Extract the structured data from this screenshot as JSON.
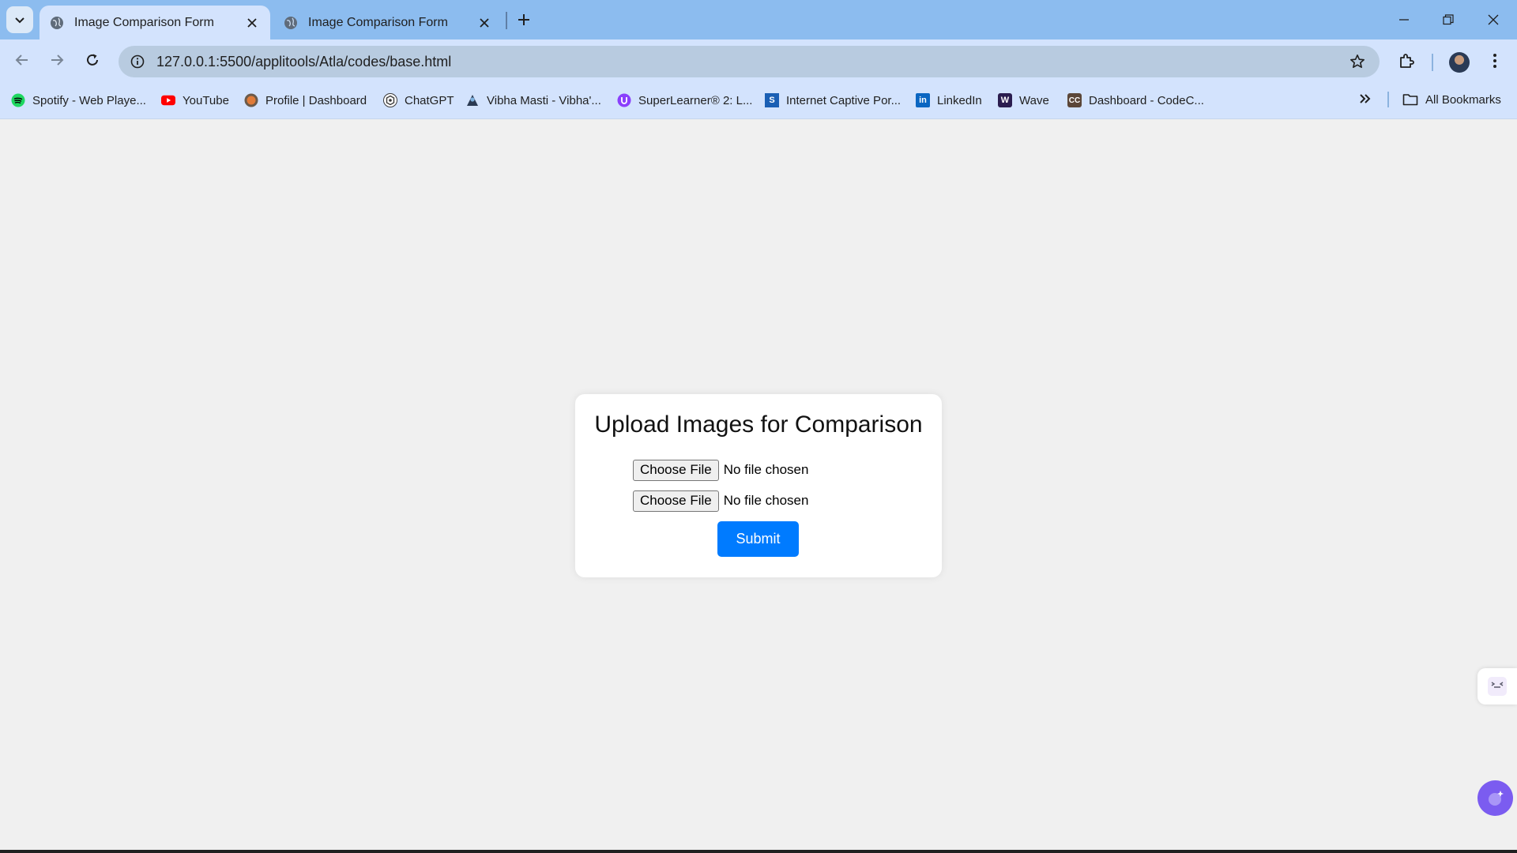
{
  "browser": {
    "tabs": [
      {
        "title": "Image Comparison Form",
        "active": true
      },
      {
        "title": "Image Comparison Form",
        "active": false
      }
    ],
    "address_bar": {
      "url": "127.0.0.1:5500/applitools/Atla/codes/base.html"
    },
    "bookmarks": [
      {
        "label": "Spotify - Web Playe...",
        "icon": "spotify-icon",
        "color": "#1ed760"
      },
      {
        "label": "YouTube",
        "icon": "youtube-icon",
        "color": "#ff0000"
      },
      {
        "label": "Profile | Dashboard",
        "icon": "profile-icon",
        "color": "#e07b39"
      },
      {
        "label": "ChatGPT",
        "icon": "chatgpt-icon",
        "color": "#3a3a3a"
      },
      {
        "label": "Vibha Masti - Vibha'...",
        "icon": "vibha-icon",
        "color": "#2b3a52"
      },
      {
        "label": "SuperLearner® 2: L...",
        "icon": "superlearner-icon",
        "color": "#8a3ffc"
      },
      {
        "label": "Internet Captive Por...",
        "icon": "captive-portal-icon",
        "color": "#1a5fb4"
      },
      {
        "label": "LinkedIn",
        "icon": "linkedin-icon",
        "color": "#0a66c2"
      },
      {
        "label": "Wave",
        "icon": "wave-icon",
        "color": "#2b1d4f"
      },
      {
        "label": "Dashboard - CodeC...",
        "icon": "codechef-icon",
        "color": "#5b4638"
      }
    ],
    "all_bookmarks_label": "All Bookmarks"
  },
  "page": {
    "heading": "Upload Images for Comparison",
    "file_inputs": [
      {
        "button_label": "Choose File",
        "status": "No file chosen"
      },
      {
        "button_label": "Choose File",
        "status": "No file chosen"
      }
    ],
    "submit_label": "Submit"
  },
  "colors": {
    "accent": "#007bff",
    "tab_strip": "#8cbcef",
    "toolbar": "#d3e3fd",
    "page_background": "#f0f0f0"
  }
}
